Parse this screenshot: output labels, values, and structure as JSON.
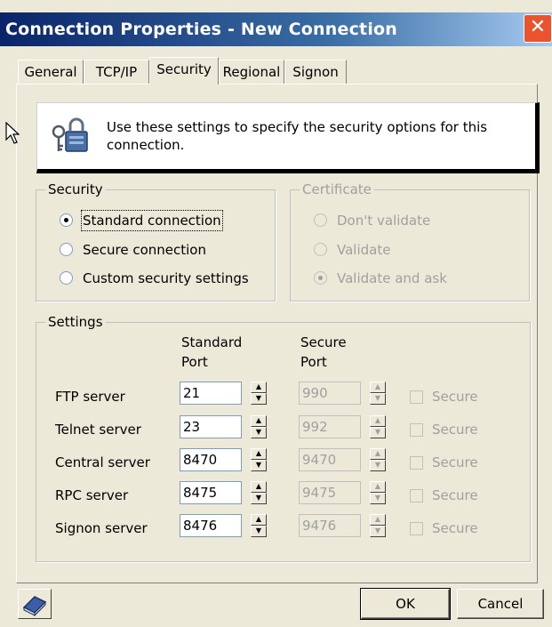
{
  "window": {
    "title": "Connection Properties - New Connection",
    "close_glyph": "✕"
  },
  "tabs": [
    {
      "label": "General"
    },
    {
      "label": "TCP/IP"
    },
    {
      "label": "Security",
      "active": true
    },
    {
      "label": "Regional"
    },
    {
      "label": "Signon"
    }
  ],
  "info": {
    "icon": "key-lock-icon",
    "text": "Use these settings to specify the security options for this connection."
  },
  "security": {
    "group_label": "Security",
    "options": [
      {
        "label": "Standard connection",
        "checked": true
      },
      {
        "label": "Secure connection",
        "checked": false
      },
      {
        "label": "Custom security settings",
        "checked": false
      }
    ]
  },
  "certificate": {
    "group_label": "Certificate",
    "options": [
      {
        "label": "Don't validate",
        "checked": false
      },
      {
        "label": "Validate",
        "checked": false
      },
      {
        "label": "Validate and ask",
        "checked": true
      }
    ]
  },
  "settings": {
    "group_label": "Settings",
    "col_standard": [
      "Standard",
      "Port"
    ],
    "col_secure": [
      "Secure",
      "Port"
    ],
    "secure_checkbox_label": "Secure",
    "rows": [
      {
        "label": "FTP server",
        "standard_port": "21",
        "secure_port": "990"
      },
      {
        "label": "Telnet server",
        "standard_port": "23",
        "secure_port": "992"
      },
      {
        "label": "Central server",
        "standard_port": "8470",
        "secure_port": "9470"
      },
      {
        "label": "RPC server",
        "standard_port": "8475",
        "secure_port": "9475"
      },
      {
        "label": "Signon server",
        "standard_port": "8476",
        "secure_port": "9476"
      }
    ]
  },
  "buttons": {
    "ok": "OK",
    "cancel": "Cancel",
    "help_icon": "help-book-icon"
  }
}
